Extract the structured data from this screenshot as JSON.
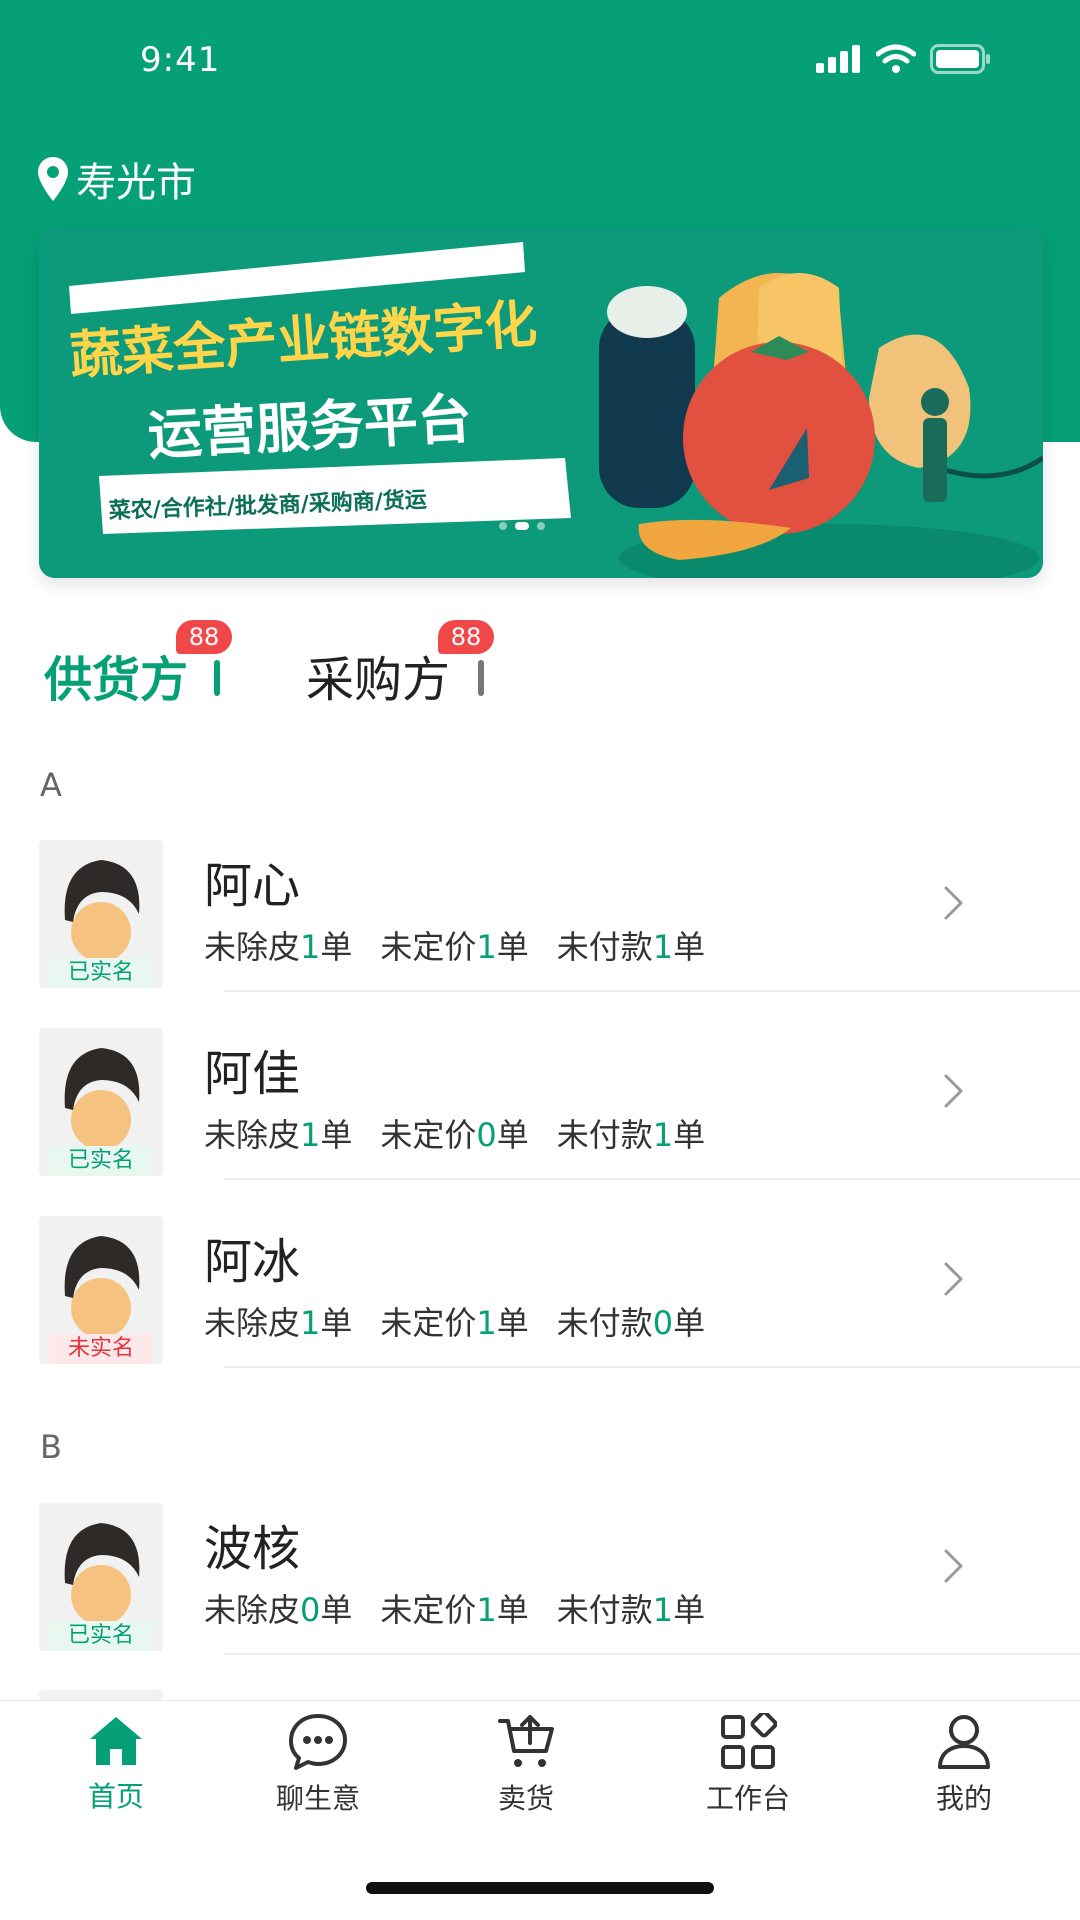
{
  "status_bar": {
    "time": "9:41"
  },
  "location": {
    "city": "寿光市"
  },
  "banner": {
    "headline": "蔬菜全产业链数字化",
    "subline": "运营服务平台",
    "tagline": "菜农/合作社/批发商/采购商/货运"
  },
  "tabs": [
    {
      "label": "供货方",
      "badge": "88",
      "active": true
    },
    {
      "label": "采购方",
      "badge": "88",
      "active": false
    }
  ],
  "stat_labels": {
    "peel": "未除皮",
    "price": "未定价",
    "pay": "未付款",
    "unit": "单"
  },
  "sections": [
    {
      "letter": "A",
      "rows": [
        {
          "name": "阿心",
          "tag": "已实名",
          "peel": "1",
          "price": "1",
          "pay": "1"
        },
        {
          "name": "阿佳",
          "tag": "已实名",
          "peel": "1",
          "price": "0",
          "pay": "1"
        },
        {
          "name": "阿冰",
          "tag": "未实名",
          "peel": "1",
          "price": "1",
          "pay": "0"
        }
      ]
    },
    {
      "letter": "B",
      "rows": [
        {
          "name": "波核",
          "tag": "已实名",
          "peel": "0",
          "price": "1",
          "pay": "1"
        }
      ]
    }
  ],
  "tabbar": [
    {
      "label": "首页",
      "icon": "home-icon",
      "active": true
    },
    {
      "label": "聊生意",
      "icon": "chat-icon",
      "active": false
    },
    {
      "label": "卖货",
      "icon": "cart-icon",
      "active": false
    },
    {
      "label": "工作台",
      "icon": "grid-icon",
      "active": false
    },
    {
      "label": "我的",
      "icon": "user-icon",
      "active": false
    }
  ],
  "colors": {
    "brand": "#05a077",
    "badge": "#f04848",
    "unverified": "#e5323c"
  }
}
